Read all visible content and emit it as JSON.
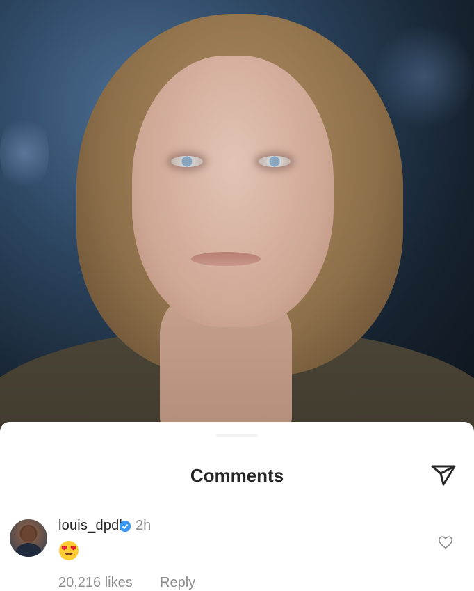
{
  "sheet": {
    "title": "Comments"
  },
  "comment": {
    "username": "louis_dpdl",
    "time": "2h",
    "likes": "20,216 likes",
    "reply_label": "Reply",
    "emoji": "smiling-face-with-heart-eyes"
  },
  "icons": {
    "send": "paper-plane-icon",
    "verified": "verified-badge-icon",
    "like": "heart-outline-icon"
  },
  "colors": {
    "text": "#262626",
    "secondary": "#8e8e8e",
    "verified": "#3897f0"
  }
}
